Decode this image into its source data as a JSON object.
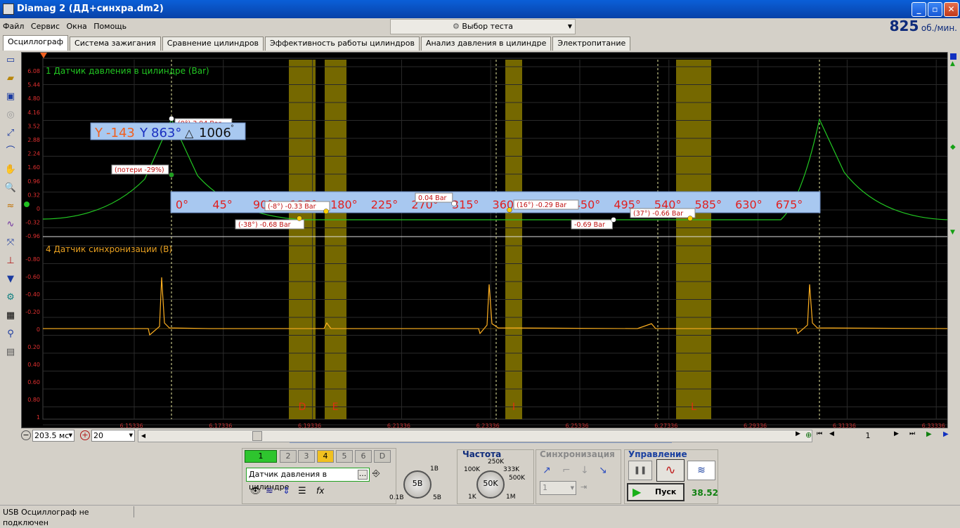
{
  "window": {
    "title": "Diamag 2 (ДД+синхра.dm2)",
    "min": "_",
    "max": "▫",
    "close": "✕"
  },
  "menu": [
    "Файл",
    "Сервис",
    "Окна",
    "Помощь"
  ],
  "test_select": {
    "label": "Выбор теста"
  },
  "rpm": {
    "value": "825",
    "unit": "об./мин."
  },
  "tabs": [
    "Осциллограф",
    "Система зажигания",
    "Сравнение цилиндров",
    "Эффективность работы цилиндров",
    "Анализ давления в цилиндре",
    "Электропитание"
  ],
  "active_tab": 0,
  "channels": {
    "ch1": {
      "label": "1 Датчик давления в цилиндре (Bar)",
      "color": "#22c822",
      "y_ticks": [
        "6.08",
        "5.44",
        "4.80",
        "4.16",
        "3.52",
        "2.88",
        "2.24",
        "1.60",
        "0.96",
        "0.32",
        "0",
        "-0.32",
        "-0.96"
      ]
    },
    "ch4": {
      "label": "4 Датчик синхронизации (В)",
      "color": "#ffb020",
      "y_ticks": [
        "-0.80",
        "-0.60",
        "-0.40",
        "-0.20",
        "0",
        "0.20",
        "0.40",
        "0.60",
        "0.80",
        "1"
      ]
    }
  },
  "x_ticks": [
    "6.15336",
    "6.17336",
    "6.19336",
    "6.21336",
    "6.23336",
    "6.25336",
    "6.27336",
    "6.29336",
    "6.31336",
    "6.33336"
  ],
  "markers": {
    "cursor1": "-143",
    "cursor2": "863°",
    "delta_symbol": "△",
    "delta": "1006",
    "delta_unit": "°"
  },
  "angle_ruler": [
    "0°",
    "45°",
    "90°",
    "135°",
    "180°",
    "225°",
    "270°",
    "315°",
    "360°",
    "405°",
    "450°",
    "495°",
    "540°",
    "585°",
    "630°",
    "675°"
  ],
  "ann": [
    "(потери -29%)",
    "(-8°) -0.33 Bar",
    "(-38°) -0.68 Bar",
    "0.04 Bar",
    "(16°) -0.29 Bar",
    "-0.69 Bar",
    "(37°) -0.66 Bar",
    "(0°) 3.94 Bar"
  ],
  "zones": [
    "D",
    "E",
    "I",
    "L"
  ],
  "bottom": {
    "timebase": "203.5 мс",
    "scale": "20",
    "page": "1"
  },
  "panel": {
    "channels": [
      "1",
      "2",
      "3",
      "4",
      "5",
      "6",
      "D"
    ],
    "sensor": "Датчик давления в цилиндре",
    "sensor_btn": "...",
    "volt_knob": {
      "value": "5В",
      "min": "0.1В",
      "max": "5В",
      "top": "1В"
    },
    "freq": {
      "title": "Частота",
      "value": "50K",
      "labels": [
        "100K",
        "250K",
        "333K",
        "500K",
        "1K",
        "1M"
      ]
    },
    "sync": {
      "title": "Синхронизация",
      "value": "1"
    },
    "control": {
      "title": "Управление",
      "start": "Пуск",
      "value": "38.52"
    }
  },
  "status": "USB Осциллограф не подключен"
}
